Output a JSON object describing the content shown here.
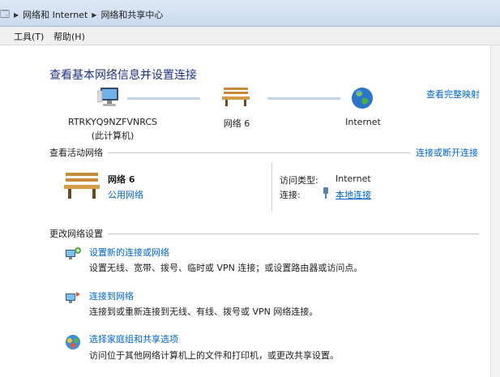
{
  "address_bar": {
    "crumbs": [
      "网络和 Internet",
      "网络和共享中心"
    ]
  },
  "menu": {
    "tools": "工具(T)",
    "help": "帮助(H)"
  },
  "main": {
    "title": "查看基本网络信息并设置连接",
    "view_full_map": "查看完整映射",
    "nodes": {
      "computer_name": "RTRKYQ9NZFVNRCS",
      "computer_sub": "(此计算机)",
      "network_name": "网络  6",
      "internet_name": "Internet"
    },
    "active_section": {
      "heading": "查看活动网络",
      "connect_link": "连接或断开连接",
      "network_name": "网络  6",
      "network_type": "公用网络",
      "access_type_label": "访问类型:",
      "access_type_value": "Internet",
      "connection_label": "连接:",
      "connection_value": "本地连接"
    },
    "change_section": {
      "heading": "更改网络设置",
      "items": [
        {
          "title": "设置新的连接或网络",
          "desc": "设置无线、宽带、拨号、临时或 VPN 连接；或设置路由器或访问点。"
        },
        {
          "title": "连接到网络",
          "desc": "连接到或重新连接到无线、有线、拨号或 VPN 网络连接。"
        },
        {
          "title": "选择家庭组和共享选项",
          "desc": "访问位于其他网络计算机上的文件和打印机，或更改共享设置。"
        }
      ]
    }
  },
  "colors": {
    "title": "#1e3287",
    "link": "#0066cc",
    "address_bar": "#cddcf0"
  }
}
